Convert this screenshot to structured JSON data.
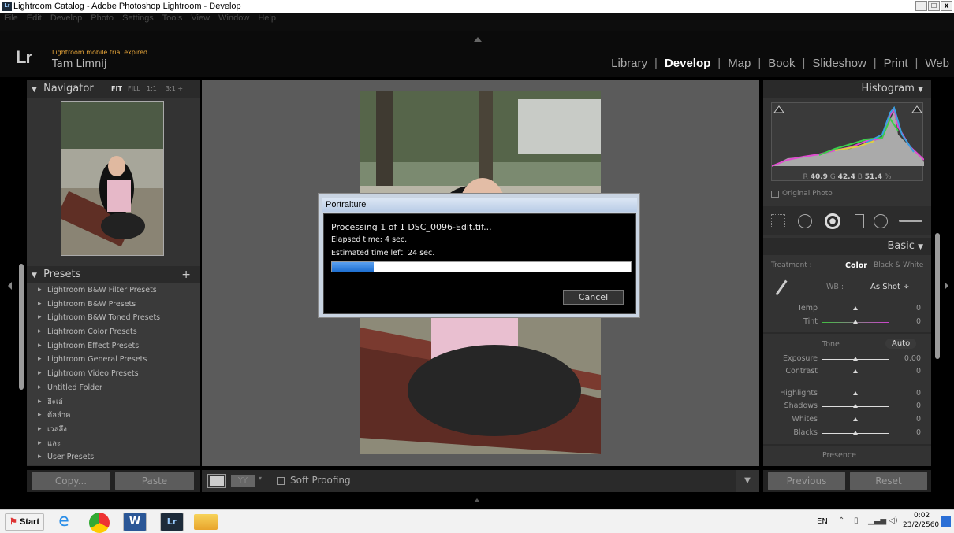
{
  "window": {
    "title": "Lightroom Catalog - Adobe Photoshop Lightroom - Develop",
    "app_icon": "Lr",
    "min": "_",
    "max": "□",
    "close": "x"
  },
  "menu": [
    "File",
    "Edit",
    "Develop",
    "Photo",
    "Settings",
    "Tools",
    "View",
    "Window",
    "Help"
  ],
  "identity": {
    "logo": "Lr",
    "trial": "Lightroom mobile trial expired",
    "user": "Tam Limnij"
  },
  "modules": [
    "Library",
    "Develop",
    "Map",
    "Book",
    "Slideshow",
    "Print",
    "Web"
  ],
  "active_module": "Develop",
  "navigator": {
    "title": "Navigator",
    "fit": "FIT",
    "fill": "FILL",
    "r1": "1:1",
    "r3": "3:1 ÷"
  },
  "presets": {
    "title": "Presets",
    "add": "+",
    "items": [
      "Lightroom B&W Filter Presets",
      "Lightroom B&W Presets",
      "Lightroom B&W Toned Presets",
      "Lightroom Color Presets",
      "Lightroom Effect Presets",
      "Lightroom General Presets",
      "Lightroom Video Presets",
      "Untitled Folder",
      "ฮีะเอ่",
      "ต้ลลำค",
      "เวลลึง",
      "และ",
      "User Presets"
    ]
  },
  "left_buttons": {
    "copy": "Copy...",
    "paste": "Paste"
  },
  "toolbar": {
    "soft_proofing": "Soft Proofing"
  },
  "histogram": {
    "title": "Histogram",
    "r_label": "R",
    "r": "40.9",
    "g_label": "G",
    "g": "42.4",
    "b_label": "B",
    "b": "51.4",
    "pct": "%",
    "original": "Original Photo"
  },
  "basic": {
    "title": "Basic",
    "treatment": "Treatment :",
    "color": "Color",
    "bw": "Black & White",
    "wb": "WB :",
    "wb_value": "As Shot ÷",
    "temp": "Temp",
    "temp_v": "0",
    "tint": "Tint",
    "tint_v": "0",
    "tone": "Tone",
    "auto": "Auto",
    "exposure": "Exposure",
    "exposure_v": "0.00",
    "contrast": "Contrast",
    "contrast_v": "0",
    "highlights": "Highlights",
    "highlights_v": "0",
    "shadows": "Shadows",
    "shadows_v": "0",
    "whites": "Whites",
    "whites_v": "0",
    "blacks": "Blacks",
    "blacks_v": "0",
    "presence": "Presence"
  },
  "right_buttons": {
    "previous": "Previous",
    "reset": "Reset"
  },
  "dialog": {
    "title": "Portraiture",
    "processing": "Processing 1 of 1 DSC_0096-Edit.tif...",
    "elapsed": "Elapsed time: 4 sec.",
    "remaining": "Estimated time left: 24 sec.",
    "progress": 0.14,
    "cancel": "Cancel"
  },
  "taskbar": {
    "start": "Start",
    "lang": "EN",
    "time": "0:02",
    "date": "23/2/2560"
  }
}
